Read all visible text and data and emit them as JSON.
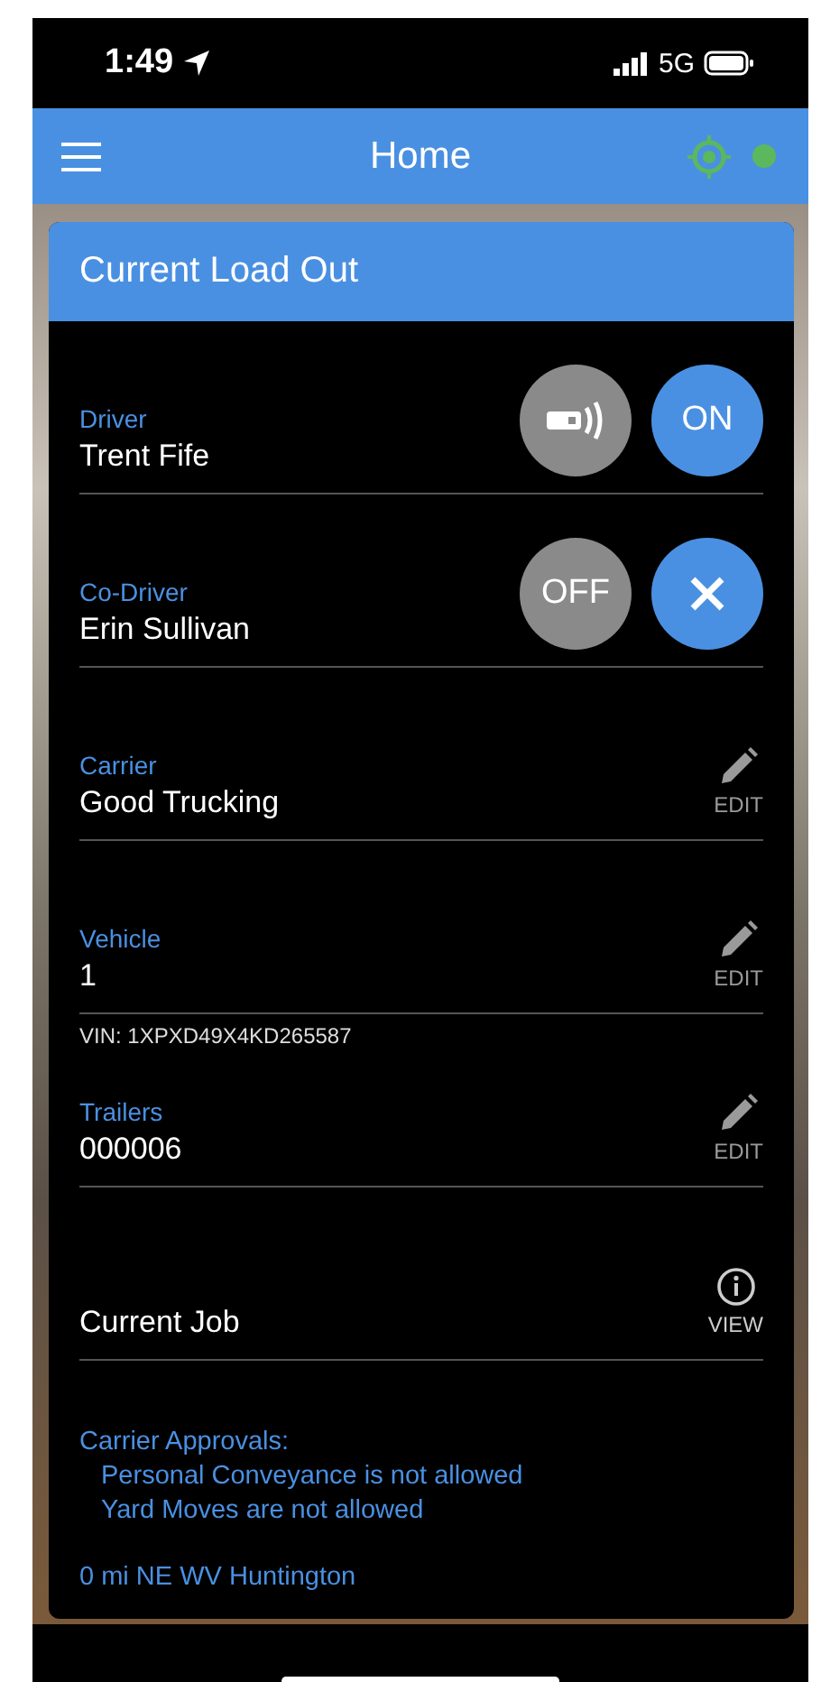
{
  "status_bar": {
    "time": "1:49",
    "network": "5G"
  },
  "header": {
    "title": "Home"
  },
  "card": {
    "title": "Current Load Out",
    "rows": [
      {
        "kind": "person",
        "label": "Driver",
        "value": "Trent Fife",
        "buttons": [
          {
            "kind": "icon",
            "color": "#8a8a8a"
          },
          {
            "kind": "text",
            "text": "ON",
            "color": "#4a90e2"
          }
        ]
      },
      {
        "kind": "person",
        "label": "Co-Driver",
        "value": "Erin Sullivan",
        "buttons": [
          {
            "kind": "text",
            "text": "OFF",
            "color": "#8a8a8a"
          },
          {
            "kind": "close",
            "color": "#4a90e2"
          }
        ]
      },
      {
        "kind": "edit",
        "label": "Carrier",
        "value": "Good Trucking",
        "action": "EDIT"
      },
      {
        "kind": "edit",
        "label": "Vehicle",
        "value": "1",
        "action": "EDIT",
        "note": "VIN: 1XPXD49X4KD265587"
      },
      {
        "kind": "edit",
        "label": "Trailers",
        "value": "000006",
        "action": "EDIT"
      },
      {
        "kind": "view",
        "value": "Current Job",
        "action": "VIEW"
      }
    ],
    "approvals": {
      "title": "Carrier Approvals:",
      "items": [
        "Personal Conveyance is not allowed",
        "Yard Moves are not allowed"
      ]
    },
    "location": "0 mi NE WV Huntington"
  }
}
